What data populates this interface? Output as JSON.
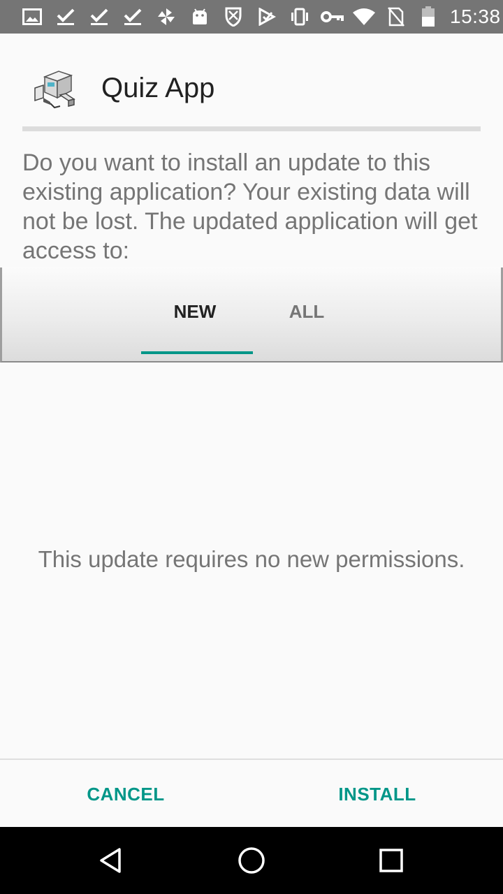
{
  "status_bar": {
    "time": "15:38",
    "left_icons": [
      "gallery-icon",
      "check-icon",
      "check-icon",
      "check-icon",
      "pinwheel-icon",
      "android-icon",
      "shield-icon",
      "play-store-icon"
    ],
    "right_icons": [
      "vibrate-icon",
      "key-icon",
      "wifi-icon",
      "no-sim-icon",
      "battery-icon"
    ]
  },
  "header": {
    "app_name": "Quiz App",
    "app_icon": "installer-icon"
  },
  "message": "Do you want to install an update to this existing application? Your existing data will not be lost. The updated application will get access to:",
  "tabs": [
    {
      "label": "NEW",
      "selected": true
    },
    {
      "label": "ALL",
      "selected": false
    }
  ],
  "body_text": "This update requires no new permissions.",
  "buttons": {
    "cancel": "CANCEL",
    "install": "INSTALL"
  },
  "colors": {
    "accent": "#009688",
    "status_bar": "#757575",
    "nav_bar": "#000000",
    "background": "#fafafa"
  },
  "nav_bar": [
    "back-icon",
    "home-icon",
    "recents-icon"
  ]
}
